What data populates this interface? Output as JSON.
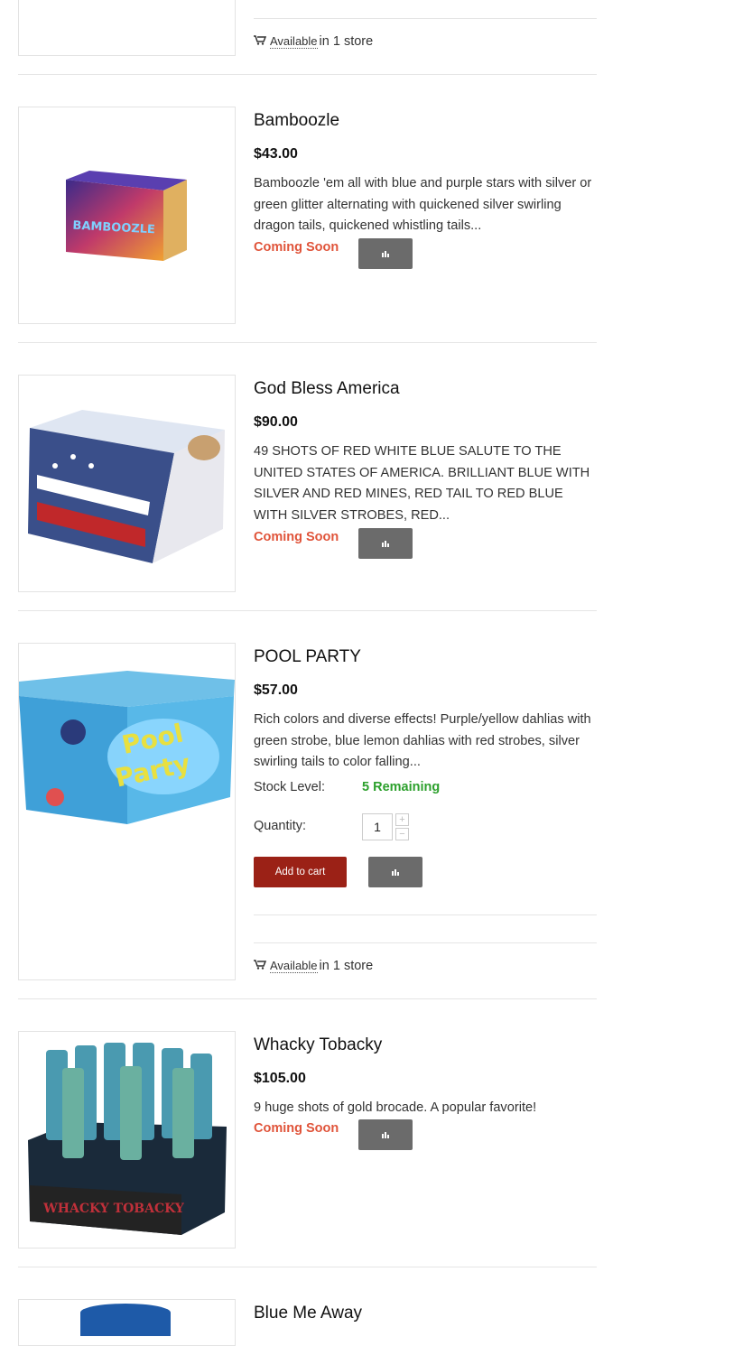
{
  "top_availability": {
    "link": "Available",
    "rest": "in 1 store"
  },
  "products": [
    {
      "name": "Bamboozle",
      "price": "$43.00",
      "description": "Bamboozle 'em all with blue and purple stars with silver or green glitter alternating with quickened silver swirling dragon tails, quickened whistling tails...",
      "status": "Coming Soon",
      "box_text": "BAMBOOZLE"
    },
    {
      "name": "God Bless America",
      "price": "$90.00",
      "description": "49 SHOTS OF RED WHITE BLUE SALUTE TO THE UNITED STATES OF AMERICA. BRILLIANT BLUE WITH SILVER AND RED MINES, RED TAIL TO RED BLUE WITH SILVER STROBES, RED...",
      "status": "Coming Soon"
    },
    {
      "name": "POOL PARTY",
      "price": "$57.00",
      "description": "Rich colors and diverse effects! Purple/yellow dahlias with green strobe, blue lemon dahlias with red strobes, silver swirling tails to color falling...",
      "stock_label": "Stock Level:",
      "stock_value": "5 Remaining",
      "quantity_label": "Quantity:",
      "quantity_value": "1",
      "add_to_cart": "Add to cart",
      "availability": {
        "link": "Available",
        "rest": "in 1 store"
      },
      "box_text_1": "Pool",
      "box_text_2": "Party"
    },
    {
      "name": "Whacky Tobacky",
      "price": "$105.00",
      "description": "9 huge shots of gold brocade. A popular favorite!",
      "status": "Coming Soon",
      "box_text": "WHACKY TOBACKY"
    },
    {
      "name": "Blue Me Away"
    }
  ],
  "icons": {
    "cart": "cart-icon",
    "compare": "bar-chart-icon",
    "plus": "+",
    "minus": "−"
  },
  "colors": {
    "coming_soon": "#e0543a",
    "stock": "#2ca02c",
    "cart_button": "#9b2116",
    "compare_button": "#6b6b6b"
  }
}
